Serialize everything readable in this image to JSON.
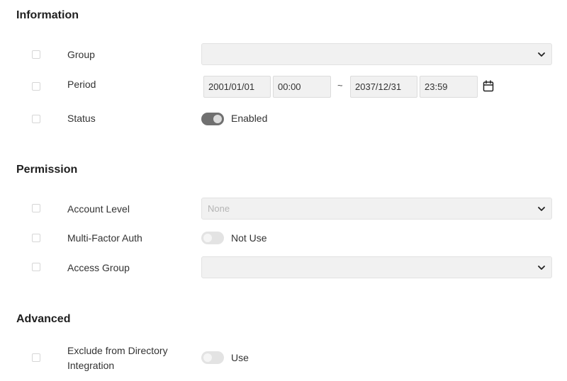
{
  "information": {
    "title": "Information",
    "group": {
      "label": "Group",
      "value": ""
    },
    "period": {
      "label": "Period",
      "start_date": "2001/01/01",
      "start_time": "00:00",
      "separator": "~",
      "end_date": "2037/12/31",
      "end_time": "23:59"
    },
    "status": {
      "label": "Status",
      "toggle_label": "Enabled",
      "on": true
    }
  },
  "permission": {
    "title": "Permission",
    "account_level": {
      "label": "Account Level",
      "value": "None"
    },
    "mfa": {
      "label": "Multi-Factor Auth",
      "toggle_label": "Not Use",
      "on": false
    },
    "access_group": {
      "label": "Access Group",
      "value": ""
    }
  },
  "advanced": {
    "title": "Advanced",
    "exclude_directory": {
      "label_line1": "Exclude from Directory",
      "label_line2": "Integration",
      "toggle_label": "Use",
      "on": false
    }
  },
  "icons": {
    "dropdown": "chevron-down-icon",
    "calendar": "calendar-icon"
  },
  "colors": {
    "field_bg": "#f1f1f1",
    "toggle_on": "#707070",
    "toggle_off": "#e3e3e3"
  }
}
